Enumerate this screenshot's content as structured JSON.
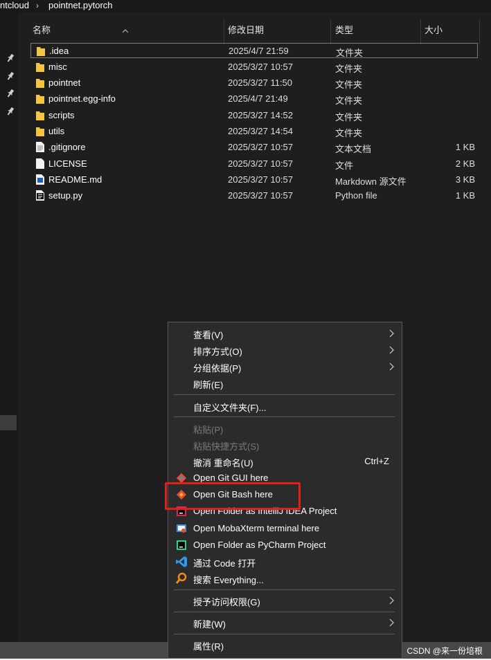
{
  "breadcrumb": {
    "parent": "ntcloud",
    "current": "pointnet.pytorch",
    "separator": "›"
  },
  "columns": {
    "name": "名称",
    "date": "修改日期",
    "type": "类型",
    "size": "大小"
  },
  "files": [
    {
      "name": ".idea",
      "date": "2025/4/7 21:59",
      "type": "文件夹",
      "size": "",
      "icon": "folder-icon"
    },
    {
      "name": "misc",
      "date": "2025/3/27 10:57",
      "type": "文件夹",
      "size": "",
      "icon": "folder-icon"
    },
    {
      "name": "pointnet",
      "date": "2025/3/27 11:50",
      "type": "文件夹",
      "size": "",
      "icon": "folder-icon"
    },
    {
      "name": "pointnet.egg-info",
      "date": "2025/4/7 21:49",
      "type": "文件夹",
      "size": "",
      "icon": "folder-icon"
    },
    {
      "name": "scripts",
      "date": "2025/3/27 14:52",
      "type": "文件夹",
      "size": "",
      "icon": "folder-icon"
    },
    {
      "name": "utils",
      "date": "2025/3/27 14:54",
      "type": "文件夹",
      "size": "",
      "icon": "folder-icon"
    },
    {
      "name": ".gitignore",
      "date": "2025/3/27 10:57",
      "type": "文本文档",
      "size": "1 KB",
      "icon": "text-file-icon"
    },
    {
      "name": "LICENSE",
      "date": "2025/3/27 10:57",
      "type": "文件",
      "size": "2 KB",
      "icon": "blank-file-icon"
    },
    {
      "name": "README.md",
      "date": "2025/3/27 10:57",
      "type": "Markdown 源文件",
      "size": "3 KB",
      "icon": "markdown-file-icon"
    },
    {
      "name": "setup.py",
      "date": "2025/3/27 10:57",
      "type": "Python file",
      "size": "1 KB",
      "icon": "python-file-icon"
    }
  ],
  "menu": {
    "view": "查看(V)",
    "sort": "排序方式(O)",
    "group": "分组依据(P)",
    "refresh": "刷新(E)",
    "customize": "自定义文件夹(F)...",
    "paste": "粘贴(P)",
    "paste_shortcut": "粘贴快捷方式(S)",
    "undo": "撤消 重命名(U)",
    "undo_shortcut": "Ctrl+Z",
    "git_gui": "Open Git GUI here",
    "git_bash": "Open Git Bash here",
    "intellij": "Open Folder as IntelliJ IDEA Project",
    "mobaxterm": "Open MobaXterm terminal here",
    "pycharm": "Open Folder as PyCharm Project",
    "vscode": "通过 Code 打开",
    "everything": "搜索 Everything...",
    "grant": "授予访问权限(G)",
    "new": "新建(W)",
    "properties": "属性(R)"
  },
  "watermark": "CSDN @来一份培根",
  "colors": {
    "highlight": "#e0201b",
    "folder": "#f4c542",
    "menu_bg": "#2b2b2b",
    "window_bg": "#1e1e1e"
  }
}
